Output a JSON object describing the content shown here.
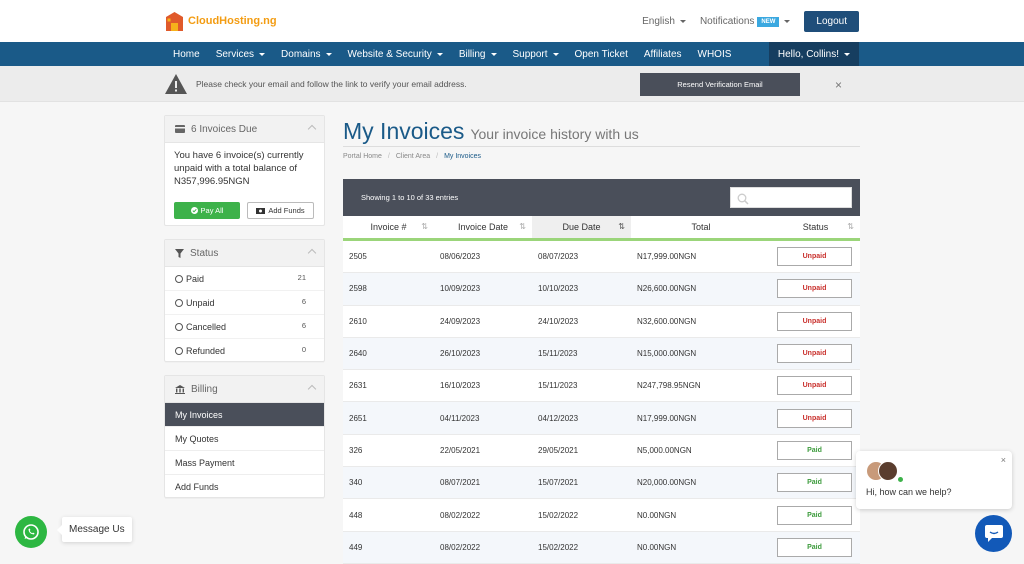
{
  "brand": {
    "name": "CloudHosting.ng",
    "accent": "#f39c12",
    "primary": "#1a5a88"
  },
  "topbar": {
    "language": "English",
    "notifications": "Notifications",
    "new_badge": "NEW",
    "logout": "Logout"
  },
  "nav": {
    "items": [
      {
        "label": "Home",
        "dropdown": false
      },
      {
        "label": "Services",
        "dropdown": true
      },
      {
        "label": "Domains",
        "dropdown": true
      },
      {
        "label": "Website & Security",
        "dropdown": true
      },
      {
        "label": "Billing",
        "dropdown": true
      },
      {
        "label": "Support",
        "dropdown": true
      },
      {
        "label": "Open Ticket",
        "dropdown": false
      },
      {
        "label": "Affiliates",
        "dropdown": false
      },
      {
        "label": "WHOIS",
        "dropdown": false
      }
    ],
    "user": "Hello, Collins!"
  },
  "alert": {
    "text": "Please check your email and follow the link to verify your email address.",
    "button": "Resend Verification Email",
    "close": "×"
  },
  "due_panel": {
    "title": "6 Invoices Due",
    "text": "You have 6 invoice(s) currently unpaid with a total balance of N357,996.95NGN",
    "pay_all": "Pay All",
    "add_funds": "Add Funds"
  },
  "status_panel": {
    "title": "Status",
    "items": [
      {
        "label": "Paid",
        "count": "21"
      },
      {
        "label": "Unpaid",
        "count": "6"
      },
      {
        "label": "Cancelled",
        "count": "6"
      },
      {
        "label": "Refunded",
        "count": "0"
      }
    ]
  },
  "billing_panel": {
    "title": "Billing",
    "items": [
      {
        "label": "My Invoices",
        "active": true
      },
      {
        "label": "My Quotes",
        "active": false
      },
      {
        "label": "Mass Payment",
        "active": false
      },
      {
        "label": "Add Funds",
        "active": false
      }
    ]
  },
  "page": {
    "title": "My Invoices",
    "subtitle": "Your invoice history with us",
    "breadcrumb": [
      "Portal Home",
      "Client Area",
      "My Invoices"
    ]
  },
  "table": {
    "showing": "Showing 1 to 10 of 33 entries",
    "search_placeholder": "",
    "columns": [
      "Invoice #",
      "Invoice Date",
      "Due Date",
      "Total",
      "Status"
    ],
    "rows": [
      {
        "invoice": "2505",
        "invoice_date": "08/06/2023",
        "due_date": "08/07/2023",
        "total": "N17,999.00NGN",
        "status": "Unpaid"
      },
      {
        "invoice": "2598",
        "invoice_date": "10/09/2023",
        "due_date": "10/10/2023",
        "total": "N26,600.00NGN",
        "status": "Unpaid"
      },
      {
        "invoice": "2610",
        "invoice_date": "24/09/2023",
        "due_date": "24/10/2023",
        "total": "N32,600.00NGN",
        "status": "Unpaid"
      },
      {
        "invoice": "2640",
        "invoice_date": "26/10/2023",
        "due_date": "15/11/2023",
        "total": "N15,000.00NGN",
        "status": "Unpaid"
      },
      {
        "invoice": "2631",
        "invoice_date": "16/10/2023",
        "due_date": "15/11/2023",
        "total": "N247,798.95NGN",
        "status": "Unpaid"
      },
      {
        "invoice": "2651",
        "invoice_date": "04/11/2023",
        "due_date": "04/12/2023",
        "total": "N17,999.00NGN",
        "status": "Unpaid"
      },
      {
        "invoice": "326",
        "invoice_date": "22/05/2021",
        "due_date": "29/05/2021",
        "total": "N5,000.00NGN",
        "status": "Paid"
      },
      {
        "invoice": "340",
        "invoice_date": "08/07/2021",
        "due_date": "15/07/2021",
        "total": "N20,000.00NGN",
        "status": "Paid"
      },
      {
        "invoice": "448",
        "invoice_date": "08/02/2022",
        "due_date": "15/02/2022",
        "total": "N0.00NGN",
        "status": "Paid"
      },
      {
        "invoice": "449",
        "invoice_date": "08/02/2022",
        "due_date": "15/02/2022",
        "total": "N0.00NGN",
        "status": "Paid"
      }
    ],
    "status_colors": {
      "Unpaid": "#c9302c",
      "Paid": "#3c9b3c"
    }
  },
  "chat": {
    "greeting": "Hi, how can we help?",
    "close": "×"
  },
  "whatsapp": {
    "label": "Message Us"
  }
}
